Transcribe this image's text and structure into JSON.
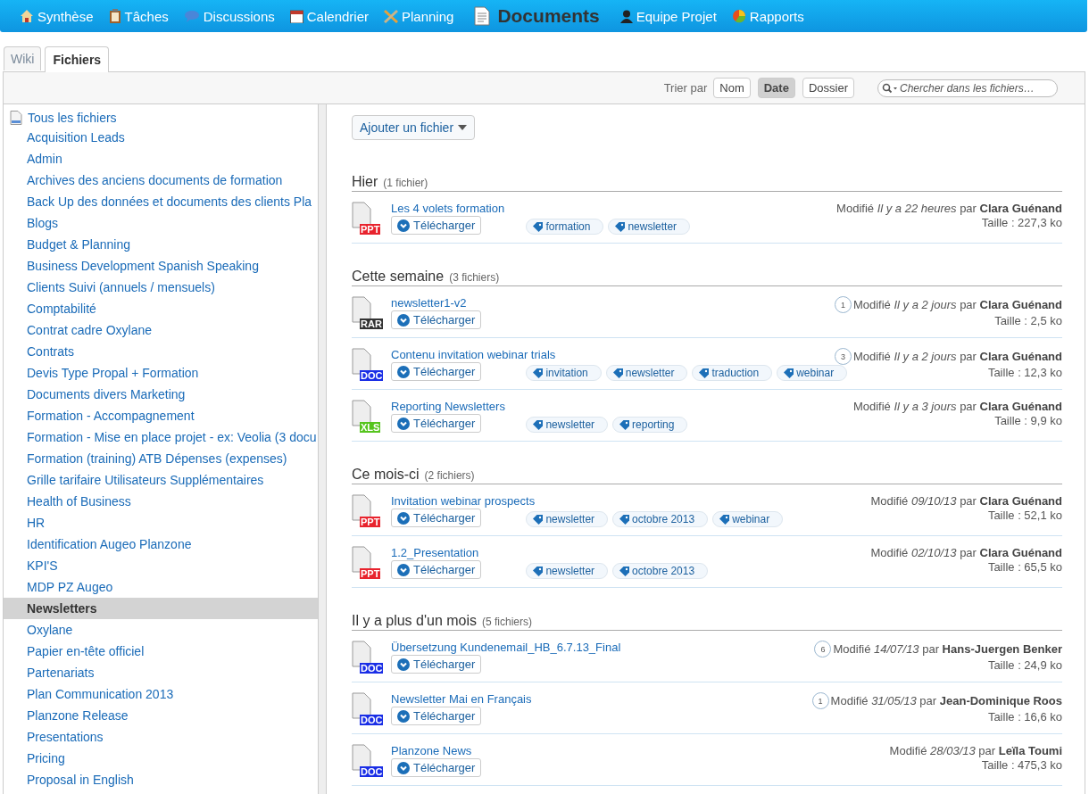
{
  "nav": [
    {
      "label": "Synthèse",
      "selected": false
    },
    {
      "label": "Tâches",
      "selected": false
    },
    {
      "label": "Discussions",
      "selected": false
    },
    {
      "label": "Calendrier",
      "selected": false
    },
    {
      "label": "Planning",
      "selected": false
    },
    {
      "label": "Documents",
      "selected": true
    },
    {
      "label": "Equipe Projet",
      "selected": false
    },
    {
      "label": "Rapports",
      "selected": false
    }
  ],
  "tabs": [
    {
      "label": "Wiki",
      "selected": false
    },
    {
      "label": "Fichiers",
      "selected": true
    }
  ],
  "sort": {
    "label": "Trier par",
    "options": [
      {
        "label": "Nom",
        "selected": false
      },
      {
        "label": "Date",
        "selected": true
      },
      {
        "label": "Dossier",
        "selected": false
      }
    ]
  },
  "search": {
    "placeholder": "Chercher dans les fichiers…"
  },
  "sidebar": {
    "root": "Tous les fichiers",
    "items": [
      {
        "label": "Acquisition Leads",
        "selected": false
      },
      {
        "label": "Admin",
        "selected": false
      },
      {
        "label": "Archives des anciens documents de formation",
        "selected": false
      },
      {
        "label": "Back Up des données et documents des clients Pla",
        "selected": false
      },
      {
        "label": "Blogs",
        "selected": false
      },
      {
        "label": "Budget & Planning",
        "selected": false
      },
      {
        "label": "Business Development Spanish Speaking",
        "selected": false
      },
      {
        "label": "Clients Suivi (annuels / mensuels)",
        "selected": false
      },
      {
        "label": "Comptabilité",
        "selected": false
      },
      {
        "label": "Contrat cadre Oxylane",
        "selected": false
      },
      {
        "label": "Contrats",
        "selected": false
      },
      {
        "label": "Devis Type Propal + Formation",
        "selected": false
      },
      {
        "label": "Documents divers Marketing",
        "selected": false
      },
      {
        "label": "Formation - Accompagnement",
        "selected": false
      },
      {
        "label": "Formation - Mise en place projet - ex: Veolia (3 docu",
        "selected": false
      },
      {
        "label": "Formation (training) ATB Dépenses (expenses)",
        "selected": false
      },
      {
        "label": "Grille tarifaire Utilisateurs Supplémentaires",
        "selected": false
      },
      {
        "label": "Health of Business",
        "selected": false
      },
      {
        "label": "HR",
        "selected": false
      },
      {
        "label": "Identification Augeo Planzone",
        "selected": false
      },
      {
        "label": "KPI'S",
        "selected": false
      },
      {
        "label": "MDP PZ Augeo",
        "selected": false
      },
      {
        "label": "Newsletters",
        "selected": true
      },
      {
        "label": "Oxylane",
        "selected": false
      },
      {
        "label": "Papier en-tête officiel",
        "selected": false
      },
      {
        "label": "Partenariats",
        "selected": false
      },
      {
        "label": "Plan Communication 2013",
        "selected": false
      },
      {
        "label": "Planzone Release",
        "selected": false
      },
      {
        "label": "Presentations",
        "selected": false
      },
      {
        "label": "Pricing",
        "selected": false
      },
      {
        "label": "Proposal in English",
        "selected": false
      }
    ]
  },
  "add_button": "Ajouter un fichier",
  "sections": [
    {
      "title": "Hier",
      "count": "(1 fichier)",
      "files": [
        {
          "name": "Les 4 volets formation",
          "ext": {
            "label": "PPT",
            "color": "#e8232d"
          },
          "download": "Télécharger",
          "tags": [
            "formation",
            "newsletter"
          ],
          "modified": "Modifié *Il y a 22 heures* par **Clara Guénand**",
          "size": "Taille : 227,3 ko"
        }
      ]
    },
    {
      "title": "Cette semaine",
      "count": "(3 fichiers)",
      "files": [
        {
          "name": "newsletter1-v2",
          "ext": {
            "label": "RAR",
            "color": "#333333"
          },
          "download": "Télécharger",
          "comments": "1",
          "modified": "Modifié *Il y a 2 jours* par **Clara Guénand**",
          "size": "Taille : 2,5 ko"
        },
        {
          "name": "Contenu invitation webinar trials",
          "ext": {
            "label": "DOC",
            "color": "#1a2ee6"
          },
          "download": "Télécharger",
          "comments": "3",
          "tags": [
            "invitation",
            "newsletter",
            "traduction",
            "webinar"
          ],
          "modified": "Modifié *Il y a 2 jours* par **Clara Guénand**",
          "size": "Taille : 12,3 ko"
        },
        {
          "name": "Reporting Newsletters",
          "ext": {
            "label": "XLS",
            "color": "#56c41e"
          },
          "download": "Télécharger",
          "tags": [
            "newsletter",
            "reporting"
          ],
          "modified": "Modifié *Il y a 3 jours* par **Clara Guénand**",
          "size": "Taille : 9,9 ko"
        }
      ]
    },
    {
      "title": "Ce mois-ci",
      "count": "(2 fichiers)",
      "files": [
        {
          "name": "Invitation webinar prospects",
          "ext": {
            "label": "PPT",
            "color": "#e8232d"
          },
          "download": "Télécharger",
          "tags": [
            "newsletter",
            "octobre 2013",
            "webinar"
          ],
          "modified": "Modifié *09/10/13* par **Clara Guénand**",
          "size": "Taille : 52,1 ko"
        },
        {
          "name": "1.2_Presentation",
          "ext": {
            "label": "PPT",
            "color": "#e8232d"
          },
          "download": "Télécharger",
          "tags": [
            "newsletter",
            "octobre 2013"
          ],
          "modified": "Modifié *02/10/13* par **Clara Guénand**",
          "size": "Taille : 65,5 ko"
        }
      ]
    },
    {
      "title": "Il y a plus d'un mois",
      "count": "(5 fichiers)",
      "files": [
        {
          "name": "Übersetzung Kundenemail_HB_6.7.13_Final",
          "ext": {
            "label": "DOC",
            "color": "#1a2ee6"
          },
          "download": "Télécharger",
          "comments": "6",
          "modified": "Modifié *14/07/13* par **Hans-Juergen Benker**",
          "size": "Taille : 24,9 ko"
        },
        {
          "name": "Newsletter Mai en Français",
          "ext": {
            "label": "DOC",
            "color": "#1a2ee6"
          },
          "download": "Télécharger",
          "comments": "1",
          "modified": "Modifié *31/05/13* par **Jean-Dominique Roos**",
          "size": "Taille : 16,6 ko"
        },
        {
          "name": "Planzone News",
          "ext": {
            "label": "DOC",
            "color": "#1a2ee6"
          },
          "download": "Télécharger",
          "modified": "Modifié *28/03/13* par **Leïla Toumi**",
          "size": "Taille : 475,3 ko"
        }
      ]
    }
  ]
}
